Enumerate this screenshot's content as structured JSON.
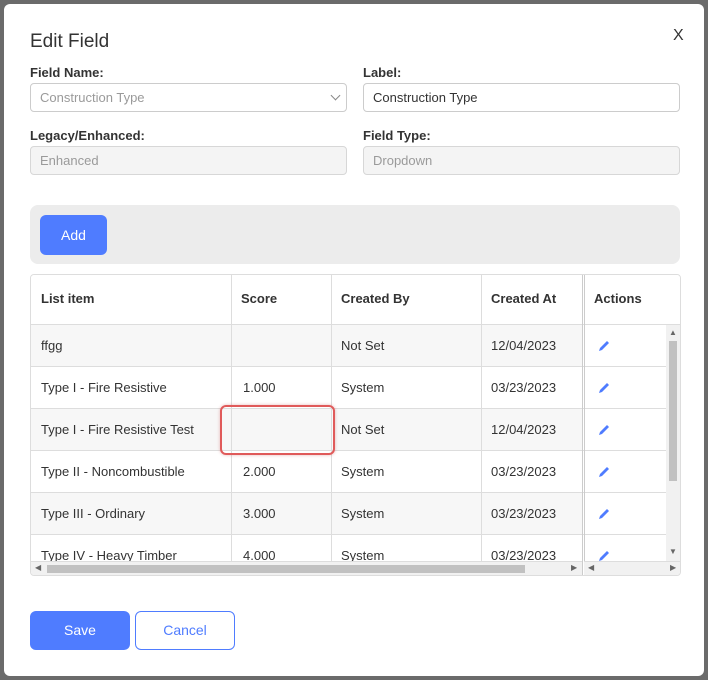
{
  "dialog": {
    "title": "Edit Field",
    "close_label": "X"
  },
  "form": {
    "field_name_label": "Field Name:",
    "field_name_value": "Construction Type",
    "label_label": "Label:",
    "label_value": "Construction Type",
    "legacy_label": "Legacy/Enhanced:",
    "legacy_value": "Enhanced",
    "field_type_label": "Field Type:",
    "field_type_value": "Dropdown"
  },
  "toolbar": {
    "add_label": "Add"
  },
  "table": {
    "headers": [
      "List item",
      "Score",
      "Created By",
      "Created At",
      "Actions"
    ],
    "rows": [
      {
        "item": "ffgg",
        "score": "",
        "created_by": "Not Set",
        "created_at": "12/04/2023"
      },
      {
        "item": "Type I - Fire Resistive",
        "score": "1.000",
        "created_by": "System",
        "created_at": "03/23/2023"
      },
      {
        "item": "Type I - Fire Resistive Test",
        "score": "",
        "created_by": "Not Set",
        "created_at": "12/04/2023"
      },
      {
        "item": "Type II - Noncombustible",
        "score": "2.000",
        "created_by": "System",
        "created_at": "03/23/2023"
      },
      {
        "item": "Type III - Ordinary",
        "score": "3.000",
        "created_by": "System",
        "created_at": "03/23/2023"
      },
      {
        "item": "Type IV - Heavy Timber",
        "score": "4.000",
        "created_by": "System",
        "created_at": "03/23/2023"
      }
    ]
  },
  "footer": {
    "save_label": "Save",
    "cancel_label": "Cancel"
  },
  "colors": {
    "primary": "#4f7cff",
    "highlight": "#e05a5a"
  },
  "icons": {
    "edit": "pencil-icon",
    "dropdown": "chevron-down-icon"
  }
}
